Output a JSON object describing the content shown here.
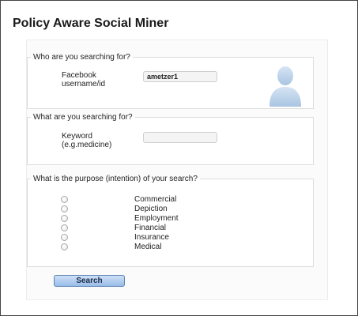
{
  "page": {
    "title": "Policy Aware Social Miner"
  },
  "who": {
    "legend": "Who are you searching for?",
    "label_line1": "Facebook",
    "label_line2": "username/id",
    "value": "ametzer1"
  },
  "what": {
    "legend": "What are you searching for?",
    "label_line1": "Keyword",
    "label_line2": "(e.g.medicine)",
    "value": ""
  },
  "purpose": {
    "legend": "What is the purpose (intention) of your search?",
    "options": [
      "Commercial",
      "Depiction",
      "Employment",
      "Financial",
      "Insurance",
      "Medical"
    ]
  },
  "actions": {
    "search_label": "Search"
  },
  "colors": {
    "accent": "#a9c8ee",
    "avatar": "#bcd3ea"
  }
}
